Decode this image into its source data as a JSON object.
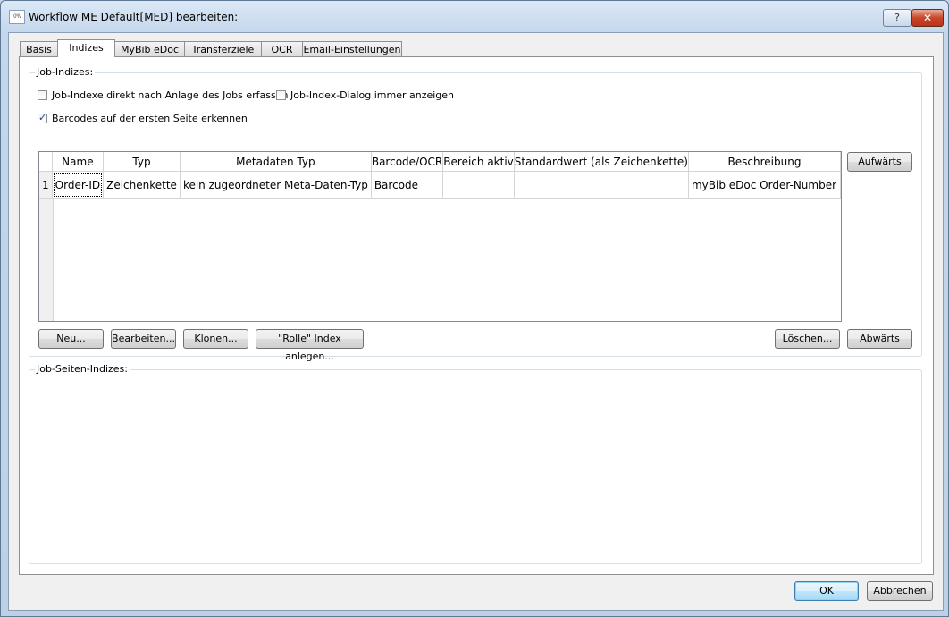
{
  "window": {
    "title": "Workflow ME Default[MED] bearbeiten:",
    "help_label": "?",
    "close_label": "✕",
    "icon_label": "KMV"
  },
  "tabs": [
    {
      "label": "Basis"
    },
    {
      "label": "Indizes"
    },
    {
      "label": "MyBib eDoc"
    },
    {
      "label": "Transferziele"
    },
    {
      "label": "OCR"
    },
    {
      "label": "Email-Einstellungen"
    }
  ],
  "job_indices": {
    "group_label": "Job-Indizes:",
    "chk_create_after": {
      "label": "Job-Indexe direkt nach Anlage des Jobs erfassen",
      "checked": false
    },
    "chk_show_dialog": {
      "label": "Job-Index-Dialog immer anzeigen",
      "checked": false
    },
    "chk_barcodes": {
      "label": "Barcodes auf der ersten Seite erkennen",
      "checked": true
    },
    "table": {
      "columns": [
        "Name",
        "Typ",
        "Metadaten Typ",
        "Barcode/OCR",
        "Bereich aktiv",
        "Standardwert (als Zeichenkette)",
        "Beschreibung"
      ],
      "rows": [
        {
          "num": "1",
          "name": "Order-ID",
          "typ": "Zeichenkette",
          "meta": "kein zugeordneter Meta-Daten-Typ",
          "barcode": "Barcode",
          "bereich": "",
          "standard": "",
          "beschreibung": "myBib eDoc Order-Number"
        }
      ]
    },
    "buttons": {
      "up": "Aufwärts",
      "down": "Abwärts",
      "new": "Neu...",
      "edit": "Bearbeiten...",
      "clone": "Klonen...",
      "role": "\"Rolle\" Index anlegen...",
      "delete": "Löschen..."
    }
  },
  "page_indices": {
    "group_label": "Job-Seiten-Indizes:"
  },
  "footer": {
    "ok": "OK",
    "cancel": "Abbrechen"
  }
}
